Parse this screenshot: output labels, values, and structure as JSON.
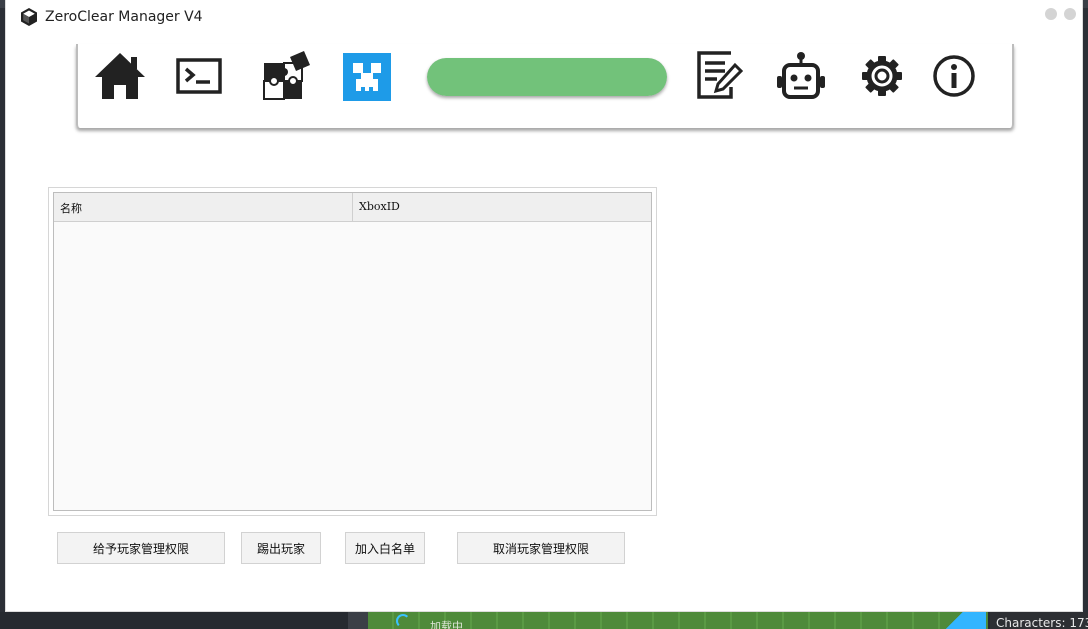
{
  "window": {
    "title": "ZeroClear Manager V4"
  },
  "toolbar": {
    "icons": [
      "home-icon",
      "terminal-icon",
      "plugins-icon",
      "minecraft-icon",
      "log-icon",
      "bot-icon",
      "settings-icon",
      "info-icon"
    ],
    "progress_fraction": 1.0,
    "accent_color": "#72c27a",
    "minecraft_color": "#1e9be8"
  },
  "player_table": {
    "columns": [
      "名称",
      "XboxID"
    ],
    "rows": []
  },
  "actions": {
    "grant_admin": "给予玩家管理权限",
    "kick_player": "踢出玩家",
    "add_whitelist": "加入白名单",
    "revoke_admin": "取消玩家管理权限"
  },
  "background": {
    "loading_text": "加载中",
    "characters_text": "Characters: 173"
  }
}
